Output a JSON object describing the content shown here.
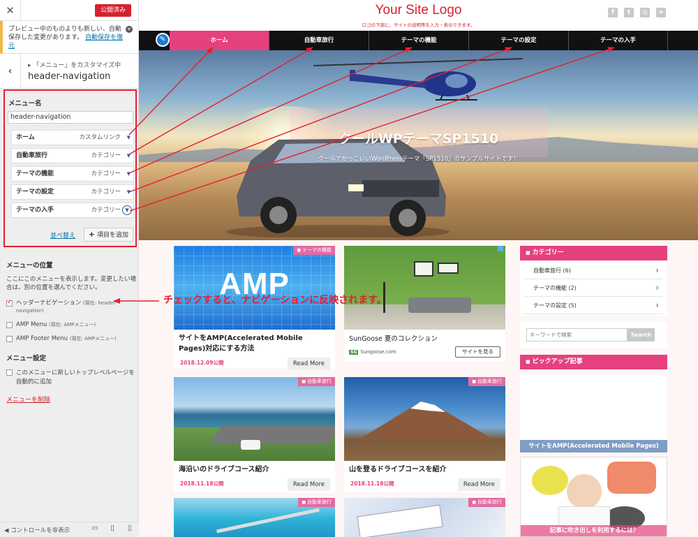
{
  "customizer": {
    "publish_label": "公開済み",
    "notice": {
      "text": "プレビュー中のものよりも新しい、自動保存した変更があります。",
      "link": "自動保存を復元"
    },
    "breadcrumb": "「メニュー」をカスタマイズ中",
    "title": "header-navigation",
    "menu_name_label": "メニュー名",
    "menu_name_value": "header-navigation",
    "menu_items": [
      {
        "label": "ホーム",
        "type": "カスタムリンク"
      },
      {
        "label": "自動車旅行",
        "type": "カテゴリー"
      },
      {
        "label": "テーマの機能",
        "type": "カテゴリー"
      },
      {
        "label": "テーマの設定",
        "type": "カテゴリー"
      },
      {
        "label": "テーマの入手",
        "type": "カテゴリー"
      }
    ],
    "reorder_label": "並べ替え",
    "add_items_label": "項目を追加",
    "locations": {
      "heading": "メニューの位置",
      "desc": "ここにこのメニューを表示します。変更したい場合は、別の位置を選んでください。",
      "options": [
        {
          "label": "ヘッダーナビゲーション",
          "note": "(現在: header-navigation)",
          "checked": true
        },
        {
          "label": "AMP Menu",
          "note": "(現在: AMPメニュー)",
          "checked": false
        },
        {
          "label": "AMP Footer Menu",
          "note": "(現在: AMPメニュー)",
          "checked": false
        }
      ]
    },
    "settings": {
      "heading": "メニュー設定",
      "auto_add": "このメニューに新しいトップレベルページを自動的に追加"
    },
    "delete_label": "メニューを削除",
    "hide_controls": "コントロールを非表示"
  },
  "preview": {
    "logo": "Your Site Logo",
    "tagline": "ロゴの下部に、サイトの説明等を入力・表示できます。",
    "nav": [
      "ホーム",
      "自動車旅行",
      "テーマの機能",
      "テーマの設定",
      "テーマの入手"
    ],
    "hero_title": "クールWPテーマSP1510",
    "hero_sub": "クールでかっこいいWordPressテーマ「SP1510」のサンプルサイトです！",
    "amp_big": "AMP",
    "posts": [
      {
        "tag": "テーマの機能",
        "title": "サイトをAMP(Accelerated Mobile Pages)対応にする方法",
        "date": "2018.12.09公開",
        "more": "Read More"
      },
      {
        "tag": "自動車旅行",
        "title": "海沿いのドライブコース紹介",
        "date": "2018.11.18公開",
        "more": "Read More"
      },
      {
        "tag": "自動車旅行",
        "title": "山を登るドライブコースを紹介",
        "date": "2018.11.18公開",
        "more": "Read More"
      },
      {
        "tag": "自動車旅行"
      },
      {
        "tag": "自動車旅行"
      }
    ],
    "ad": {
      "title": "SunGoose 夏のコレクション",
      "site_badge": "SG",
      "site": "Sungoose.com",
      "button": "サイトを見る"
    },
    "categories_heading": "カテゴリー",
    "categories": [
      "自動車旅行 (6)",
      "テーマの機能 (2)",
      "テーマの設定 (5)"
    ],
    "search_placeholder": "キーワードで検索",
    "search_button": "Search",
    "pickup_heading": "ピックアップ記事",
    "pickup_amp_caption": "サイトをAMP(Accelerated Mobile Pages)",
    "pickup2_caption": "記事に吹き出しを利用するには？"
  },
  "annotation": "チェックすると、ナビゲーションに反映されます。",
  "colors": {
    "accent_pink": "#e6417f",
    "annotation_red": "#e61e2e",
    "publish_red": "#d4232e",
    "link_blue": "#0073aa"
  }
}
